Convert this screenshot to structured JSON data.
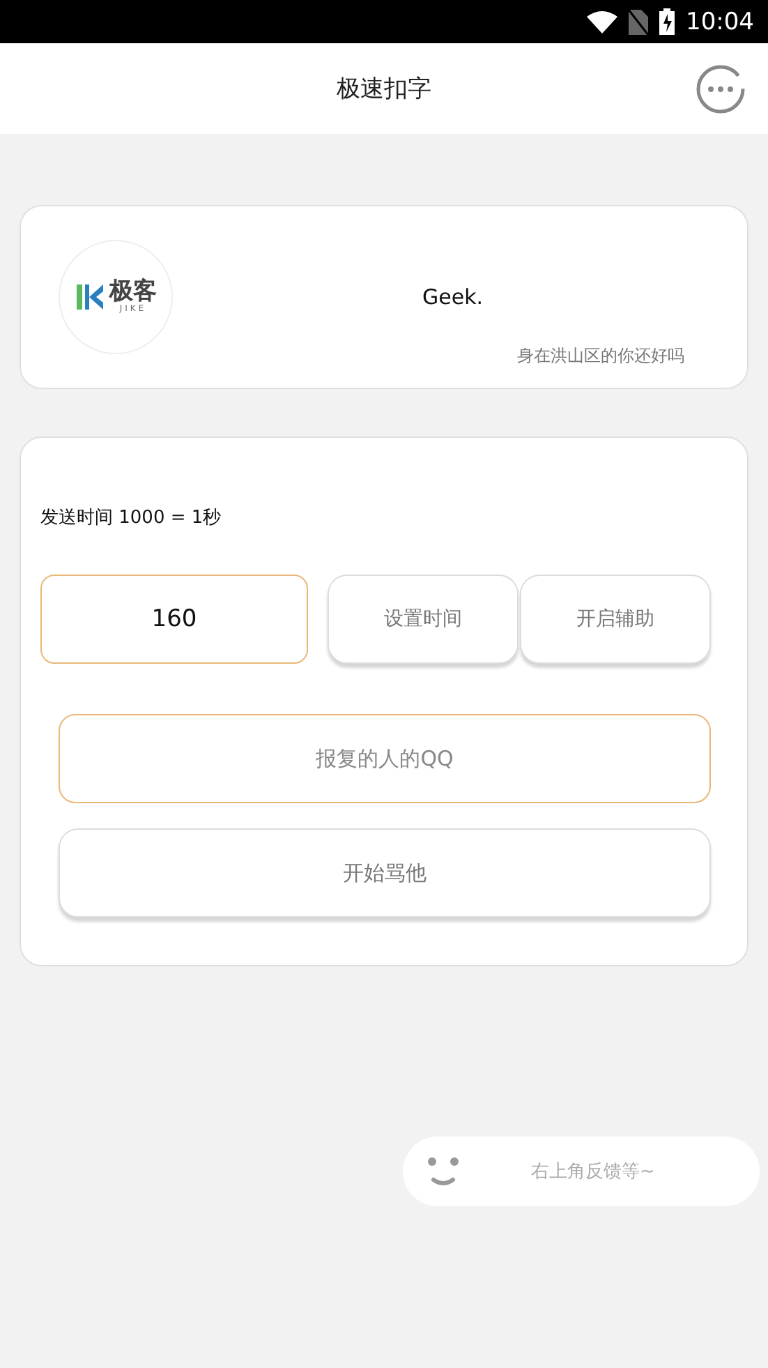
{
  "status_bar": {
    "time": "10:04"
  },
  "header": {
    "title": "极速扣字"
  },
  "profile": {
    "logo_text": "极客",
    "logo_subtext": "JIKE",
    "name": "Geek.",
    "greeting": "身在洪山区的你还好吗"
  },
  "settings": {
    "hint": "发送时间 1000 = 1秒",
    "interval_field": {
      "value": "160"
    },
    "buttons": [
      "设置时间",
      "开启辅助"
    ],
    "qq_field": {
      "placeholder": "报复的人的QQ"
    },
    "start_button": "开始骂他"
  },
  "feedback": {
    "text": "右上角反馈等~"
  }
}
